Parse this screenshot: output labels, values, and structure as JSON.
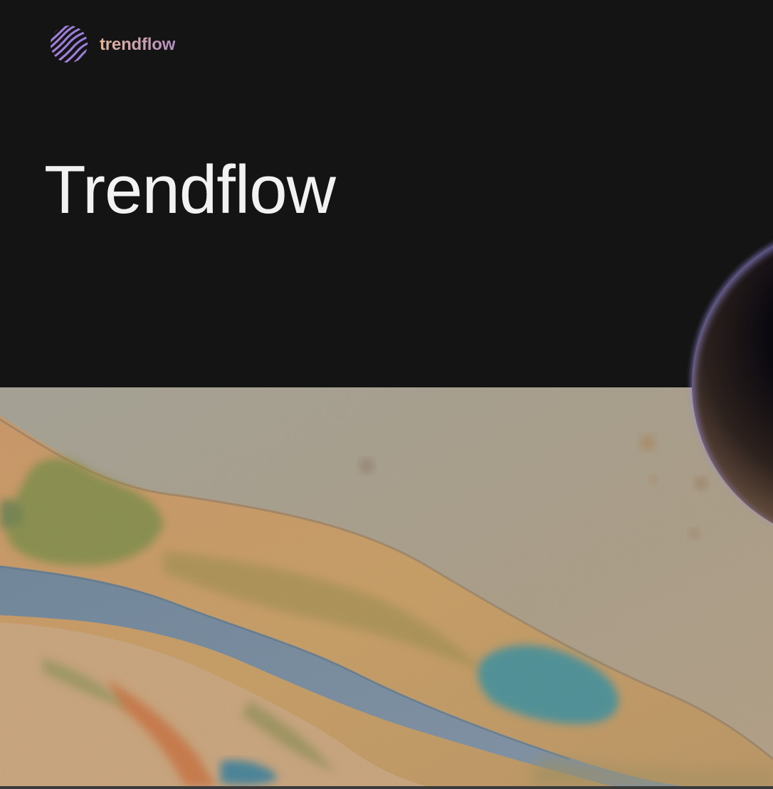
{
  "brand": {
    "name": "trendflow",
    "logo_icon": "striped-globe-logo-icon",
    "gradient_start": "#e0b69a",
    "gradient_end": "#b48ec0"
  },
  "hero": {
    "title": "Trendflow"
  },
  "colors": {
    "background": "#141414",
    "title": "#f2f2f2",
    "logo_stripe_start": "#6f63e8",
    "logo_stripe_end": "#e0b49c"
  }
}
